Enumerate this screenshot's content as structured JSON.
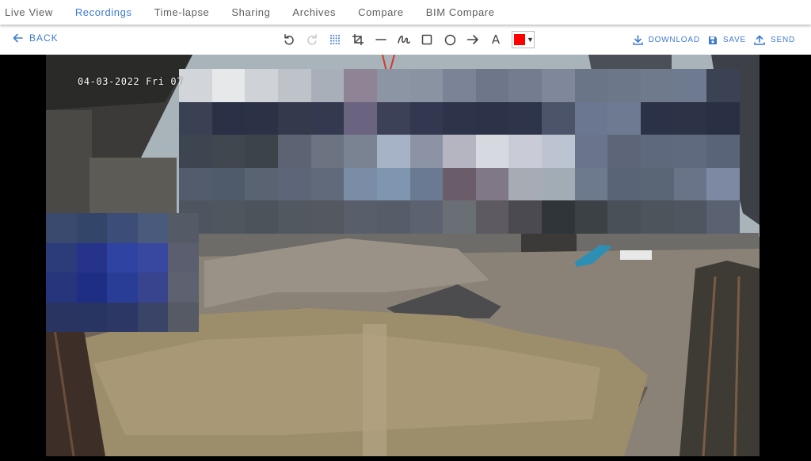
{
  "nav": {
    "tabs": [
      {
        "label": "Live View",
        "active": false
      },
      {
        "label": "Recordings",
        "active": true
      },
      {
        "label": "Time-lapse",
        "active": false
      },
      {
        "label": "Sharing",
        "active": false
      },
      {
        "label": "Archives",
        "active": false
      },
      {
        "label": "Compare",
        "active": false
      },
      {
        "label": "BIM Compare",
        "active": false
      }
    ]
  },
  "toolbar": {
    "back_label": "BACK",
    "tools": [
      "undo-icon",
      "redo-icon",
      "blur-icon",
      "crop-icon",
      "line-icon",
      "freehand-icon",
      "rectangle-icon",
      "circle-icon",
      "arrow-icon",
      "text-icon"
    ],
    "text_tool_label": "A",
    "color": "#ff0000",
    "download_label": "DOWNLOAD",
    "save_label": "SAVE",
    "send_label": "SEND"
  },
  "viewer": {
    "timestamp": "04-03-2022 Fri 07"
  },
  "colors": {
    "accent": "#3d7ad6",
    "nav_text": "#606060"
  }
}
